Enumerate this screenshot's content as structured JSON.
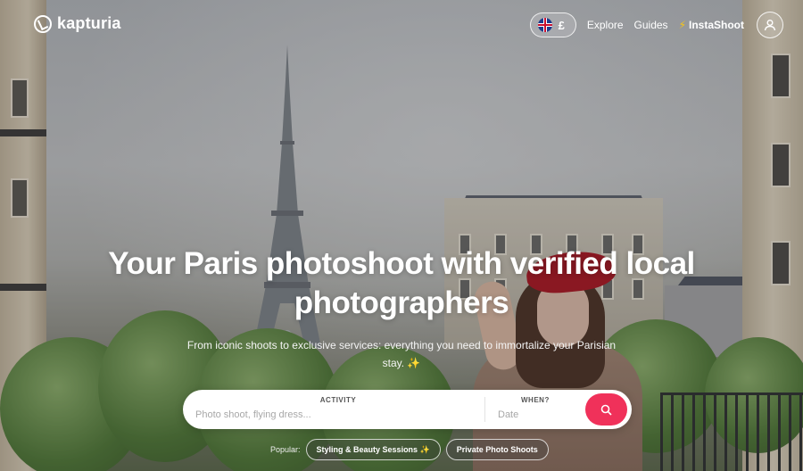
{
  "brand": {
    "name": "kapturia"
  },
  "header": {
    "currency": "£",
    "flag_icon": "uk-flag-icon",
    "nav_links": [
      "Explore",
      "Guides"
    ],
    "instashoot": {
      "icon": "lightning-icon",
      "label": "InstaShoot"
    },
    "account_icon": "user-icon"
  },
  "hero": {
    "headline_line1": "Your Paris photoshoot with verified local",
    "headline_line2": "photographers",
    "subline": "From iconic shoots to exclusive services: everything you need to immortalize your Parisian stay. ✨"
  },
  "search": {
    "activity_label": "ACTIVITY",
    "activity_placeholder": "Photo shoot, flying dress...",
    "when_label": "WHEN?",
    "when_placeholder": "Date",
    "button_icon": "search-icon"
  },
  "popular": {
    "label": "Popular:",
    "chips": [
      "Styling & Beauty Sessions ✨",
      "Private Photo Shoots"
    ]
  },
  "colors": {
    "accent": "#f0315a",
    "text": "#ffffff"
  }
}
